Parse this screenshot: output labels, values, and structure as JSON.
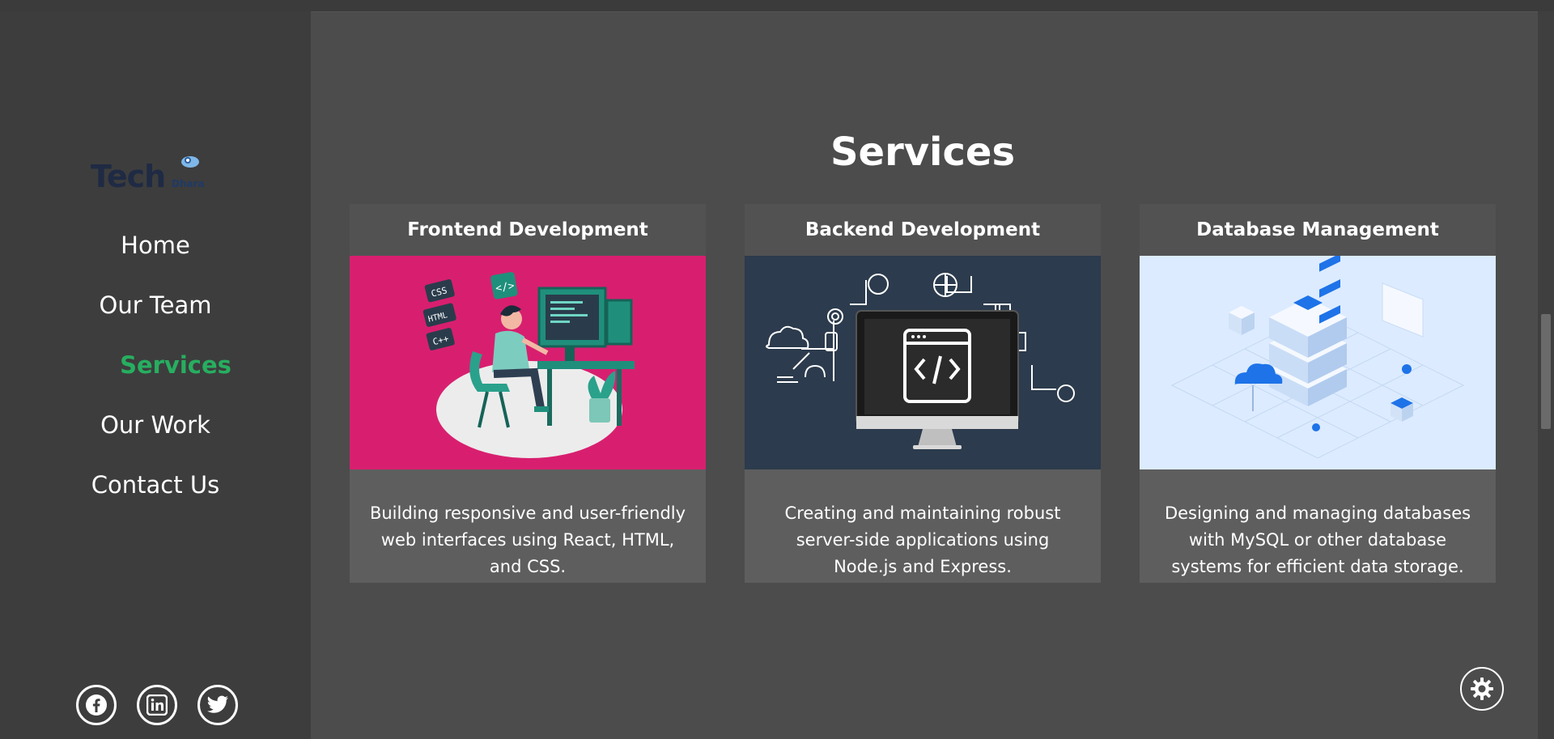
{
  "brand": {
    "name": "Tech",
    "sub": "Dhara"
  },
  "nav": [
    {
      "label": "Home"
    },
    {
      "label": "Our Team"
    },
    {
      "label": "Services",
      "active": true
    },
    {
      "label": "Our Work"
    },
    {
      "label": "Contact Us"
    }
  ],
  "socials": [
    {
      "icon": "facebook-icon"
    },
    {
      "icon": "linkedin-icon"
    },
    {
      "icon": "twitter-icon"
    }
  ],
  "section": {
    "title": "Services"
  },
  "cards": [
    {
      "title": "Frontend Development",
      "description": "Building responsive and user-friendly web interfaces using React, HTML, and CSS.",
      "illustration": "developer-at-desk-illustration",
      "accent": "#d81f6f"
    },
    {
      "title": "Backend Development",
      "description": "Creating and maintaining robust server-side applications using Node.js and Express.",
      "illustration": "monitor-code-illustration",
      "accent": "#2c3b4d"
    },
    {
      "title": "Database Management",
      "description": "Designing and managing databases with MySQL or other database systems for efficient data storage.",
      "illustration": "server-database-illustration",
      "accent": "#dcebff"
    }
  ],
  "theme_toggle": {
    "icon": "gear-icon"
  },
  "colors": {
    "active_nav": "#27ae60",
    "sidebar_bg": "#3d3d3d",
    "main_bg": "#4c4c4c"
  }
}
